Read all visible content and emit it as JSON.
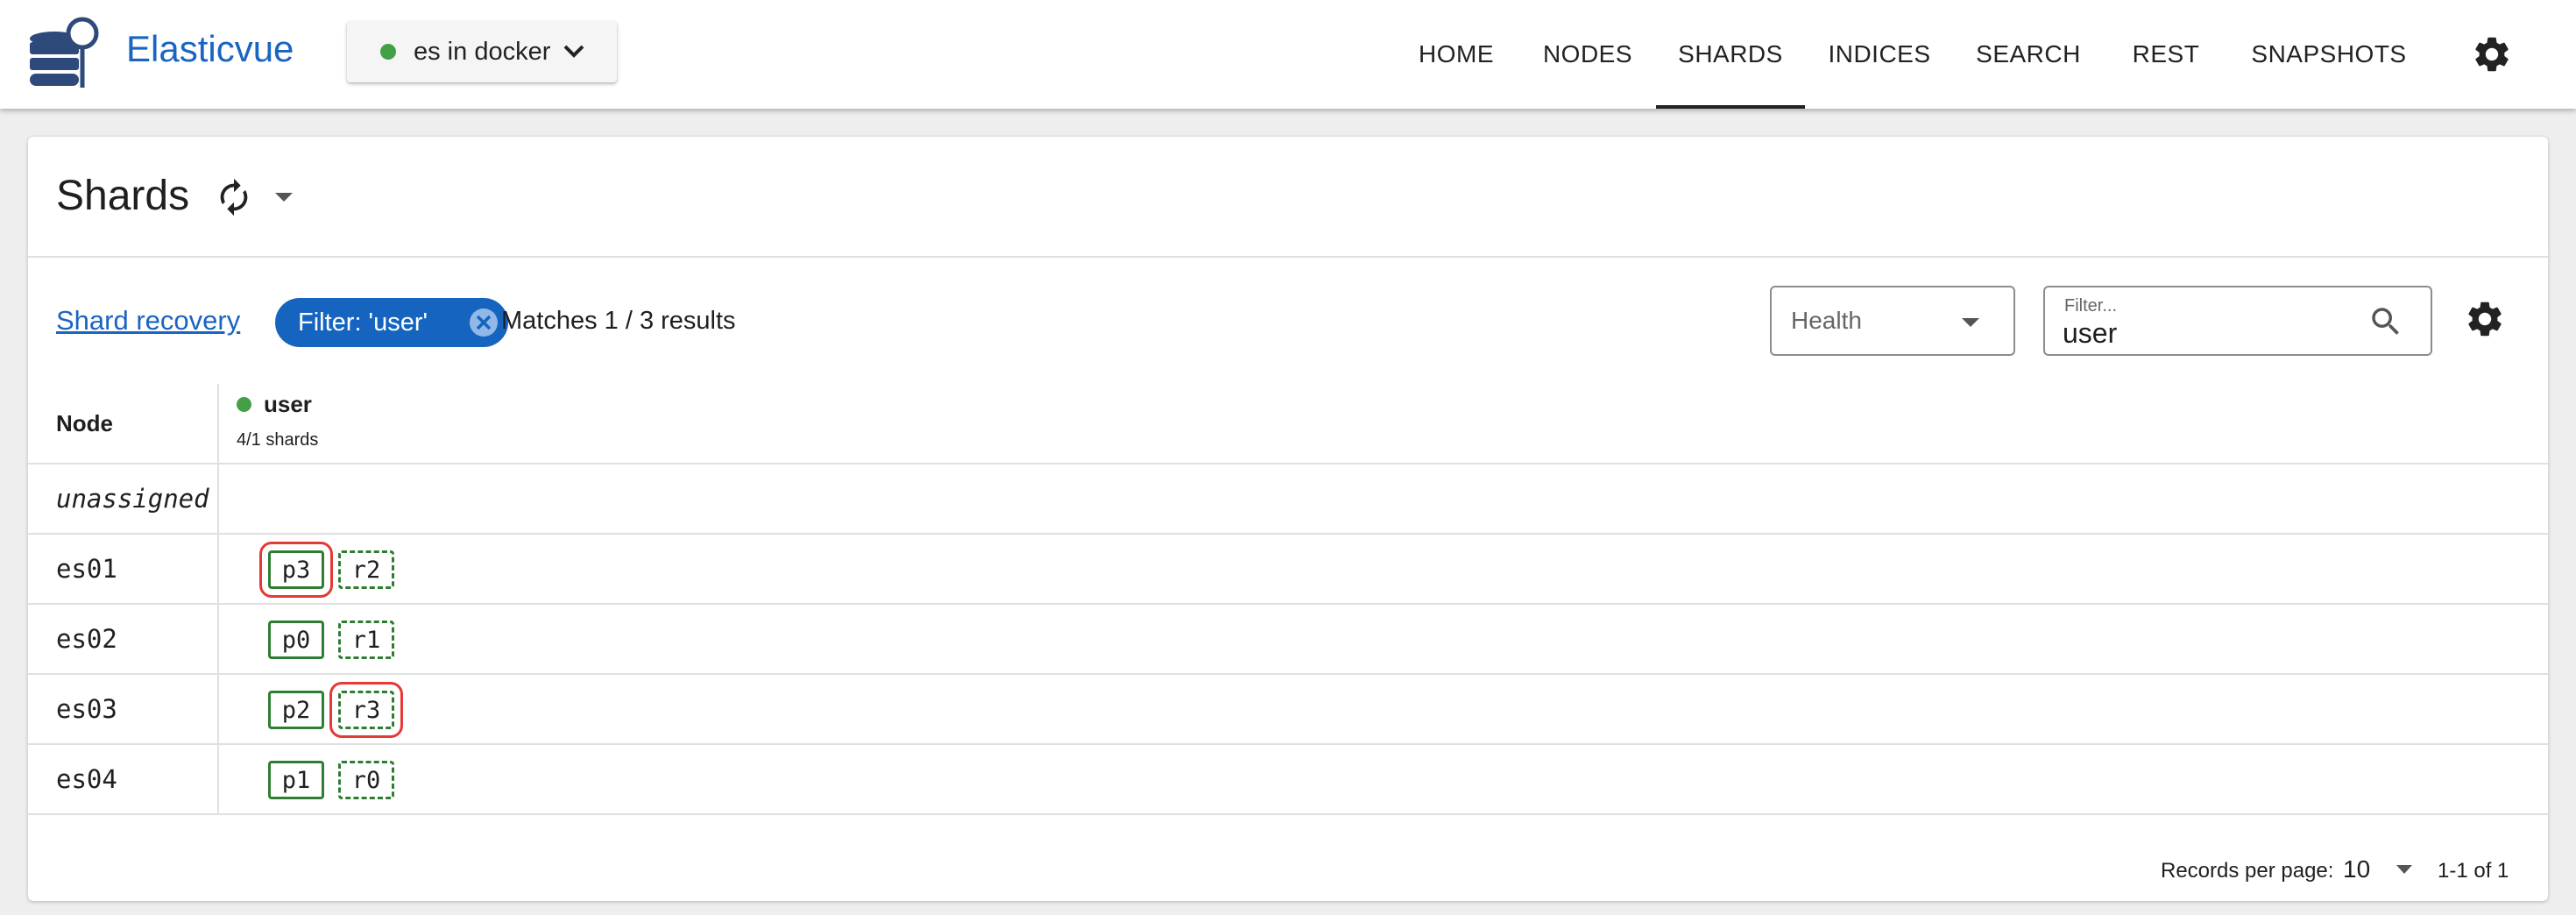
{
  "app": {
    "title": "Elasticvue"
  },
  "cluster": {
    "name": "es in docker",
    "status_color": "#43a047"
  },
  "nav": {
    "items": [
      {
        "label": "HOME",
        "active": false
      },
      {
        "label": "NODES",
        "active": false
      },
      {
        "label": "SHARDS",
        "active": true
      },
      {
        "label": "INDICES",
        "active": false
      },
      {
        "label": "SEARCH",
        "active": false
      },
      {
        "label": "REST",
        "active": false
      },
      {
        "label": "SNAPSHOTS",
        "active": false
      }
    ]
  },
  "page": {
    "title": "Shards"
  },
  "toolbar": {
    "recovery_link": "Shard recovery",
    "filter_chip": "Filter: 'user'",
    "matches": "Matches 1 / 3 results",
    "health_label": "Health",
    "filter_label": "Filter...",
    "filter_value": "user"
  },
  "table": {
    "node_header": "Node",
    "index": {
      "name": "user",
      "shards": "4/1 shards",
      "health_color": "#43a047"
    },
    "rows": [
      {
        "node": "unassigned",
        "shards": []
      },
      {
        "node": "es01",
        "shards": [
          {
            "label": "p3",
            "type": "primary",
            "highlighted": true
          },
          {
            "label": "r2",
            "type": "replica",
            "highlighted": false
          }
        ]
      },
      {
        "node": "es02",
        "shards": [
          {
            "label": "p0",
            "type": "primary",
            "highlighted": false
          },
          {
            "label": "r1",
            "type": "replica",
            "highlighted": false
          }
        ]
      },
      {
        "node": "es03",
        "shards": [
          {
            "label": "p2",
            "type": "primary",
            "highlighted": false
          },
          {
            "label": "r3",
            "type": "replica",
            "highlighted": true
          }
        ]
      },
      {
        "node": "es04",
        "shards": [
          {
            "label": "p1",
            "type": "primary",
            "highlighted": false
          },
          {
            "label": "r0",
            "type": "replica",
            "highlighted": false
          }
        ]
      }
    ]
  },
  "footer": {
    "records_per_page_label": "Records per page:",
    "records_per_page": "10",
    "page_range": "1-1 of 1"
  },
  "colors": {
    "accent": "#1a64c2",
    "chip": "#1565c0",
    "shard_border": "#2e7d32",
    "highlight": "#e53935"
  },
  "icons": [
    "logo-icon",
    "chevron-down-icon",
    "gear-icon",
    "refresh-icon",
    "close-circle-icon",
    "search-icon",
    "caret-down-icon"
  ]
}
